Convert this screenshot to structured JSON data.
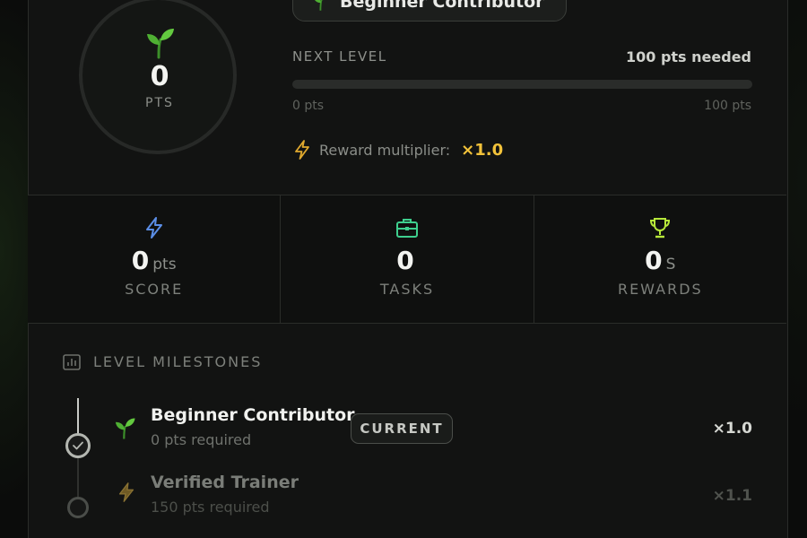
{
  "level": {
    "current_name": "Beginner Contributor",
    "points_value": "0",
    "points_unit": "PTS",
    "next_level_label": "NEXT LEVEL",
    "needed_label": "100 pts needed",
    "progress_fraction": 0,
    "range_min": "0 pts",
    "range_max": "100 pts",
    "multiplier_label": "Reward multiplier:",
    "multiplier_value": "×1.0",
    "icons": {
      "ring": "sprout-icon",
      "pill": "sprout-icon",
      "multiplier": "lightning-icon"
    }
  },
  "stats": [
    {
      "icon": "lightning-icon",
      "icon_color": "#5b8ee6",
      "value": "0",
      "unit": "pts",
      "label": "SCORE"
    },
    {
      "icon": "briefcase-icon",
      "icon_color": "#3ecf8e",
      "value": "0",
      "unit": "",
      "label": "TASKS"
    },
    {
      "icon": "trophy-icon",
      "icon_color": "#b7e83a",
      "value": "0",
      "unit": "S",
      "label": "REWARDS"
    }
  ],
  "milestones": {
    "title": "LEVEL MILESTONES",
    "title_icon": "chart-icon",
    "items": [
      {
        "name": "Beginner Contributor",
        "requirement": "0 pts required",
        "badge": "CURRENT",
        "multiplier": "×1.0",
        "icon": "sprout-icon",
        "status": "current"
      },
      {
        "name": "Verified Trainer",
        "requirement": "150 pts required",
        "multiplier": "×1.1",
        "icon": "lightning-icon",
        "status": "locked"
      }
    ]
  },
  "colors": {
    "accent_green": "#7ccf2f",
    "multiplier_gold": "#f2c23a"
  }
}
